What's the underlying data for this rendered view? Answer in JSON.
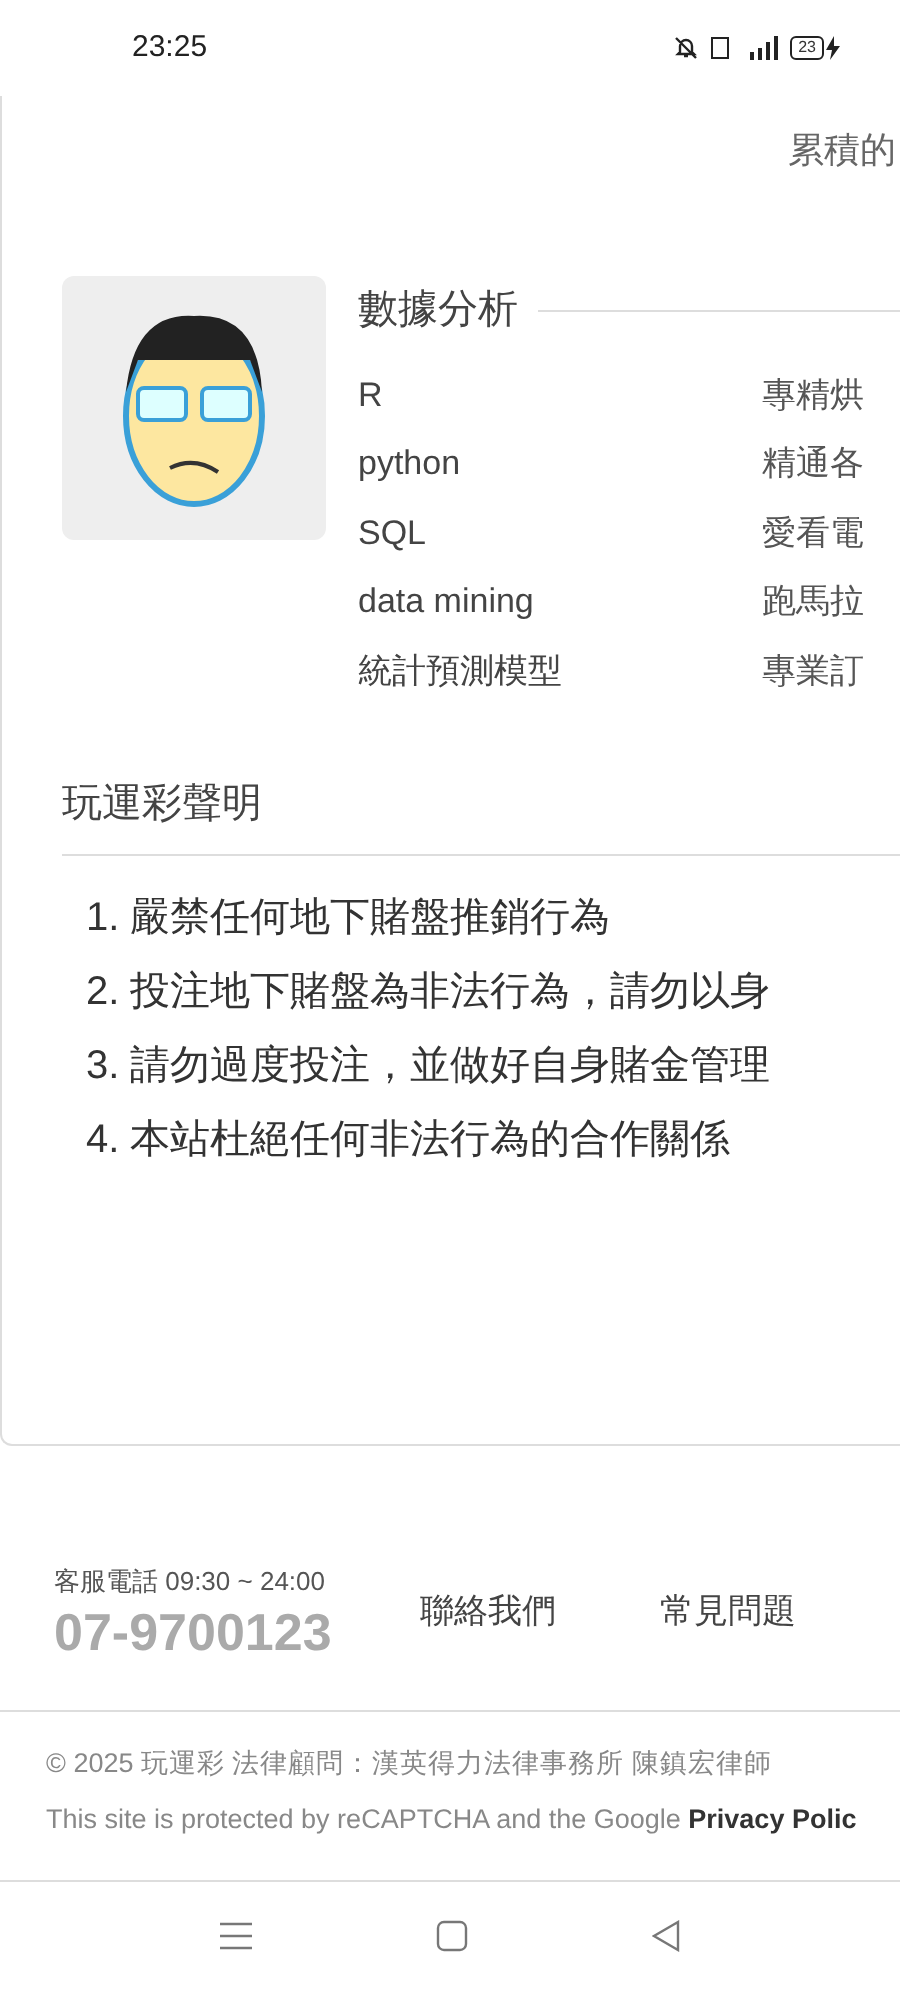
{
  "status_bar": {
    "time": "23:25",
    "battery": "23"
  },
  "top_text": "累積的",
  "skills": {
    "heading": "數據分析",
    "rows": [
      {
        "name": "R",
        "note": "專精烘"
      },
      {
        "name": "python",
        "note": "精通各"
      },
      {
        "name": "SQL",
        "note": "愛看電"
      },
      {
        "name": "data mining",
        "note": "跑馬拉"
      },
      {
        "name": "統計預測模型",
        "note": "專業訂"
      }
    ]
  },
  "statement": {
    "heading": "玩運彩聲明",
    "items": [
      "1. 嚴禁任何地下賭盤推銷行為",
      "2. 投注地下賭盤為非法行為，請勿以身",
      "3. 請勿過度投注，並做好自身賭金管理",
      "4. 本站杜絕任何非法行為的合作關係"
    ]
  },
  "footer": {
    "hotline_label": "客服電話 09:30 ~ 24:00",
    "phone": "07-9700123",
    "links": [
      "聯絡我們",
      "常見問題"
    ],
    "copyright": "© 2025 玩運彩 法律顧問：漢英得力法律事務所 陳鎮宏律師",
    "recaptcha": "This site is protected by reCAPTCHA and the Google **Privacy Polic**"
  }
}
